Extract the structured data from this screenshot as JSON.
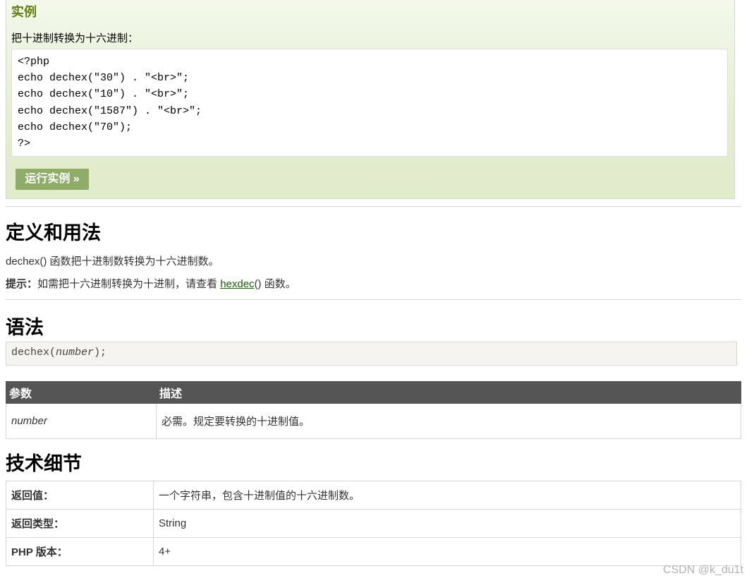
{
  "example": {
    "title": "实例",
    "desc": "把十进制转换为十六进制：",
    "code_lines": [
      "<?php",
      "echo dechex(\"30\") . \"<br>\";",
      "echo dechex(\"10\") . \"<br>\";",
      "echo dechex(\"1587\") . \"<br>\";",
      "echo dechex(\"70\");",
      "?>"
    ],
    "run_button": "运行实例 »"
  },
  "definition": {
    "heading": "定义和用法",
    "text": "dechex() 函数把十进制数转换为十六进制数。",
    "tip_label": "提示：",
    "tip_text": "如需把十六进制转换为十进制，请查看 ",
    "tip_link": "hexdec",
    "tip_link_suffix": "()",
    "tip_end": " 函数。"
  },
  "syntax": {
    "heading": "语法",
    "prefix": "dechex(",
    "param": "number",
    "suffix": ");"
  },
  "params_table": {
    "headers": [
      "参数",
      "描述"
    ],
    "rows": [
      {
        "name": "number",
        "desc": "必需。规定要转换的十进制值。"
      }
    ]
  },
  "tech": {
    "heading": "技术细节",
    "rows": [
      {
        "label": "返回值：",
        "value": "一个字符串，包含十进制值的十六进制数。"
      },
      {
        "label": "返回类型：",
        "value": "String"
      },
      {
        "label": "PHP 版本：",
        "value": "4+"
      }
    ]
  },
  "watermark": "CSDN @k_du1t"
}
